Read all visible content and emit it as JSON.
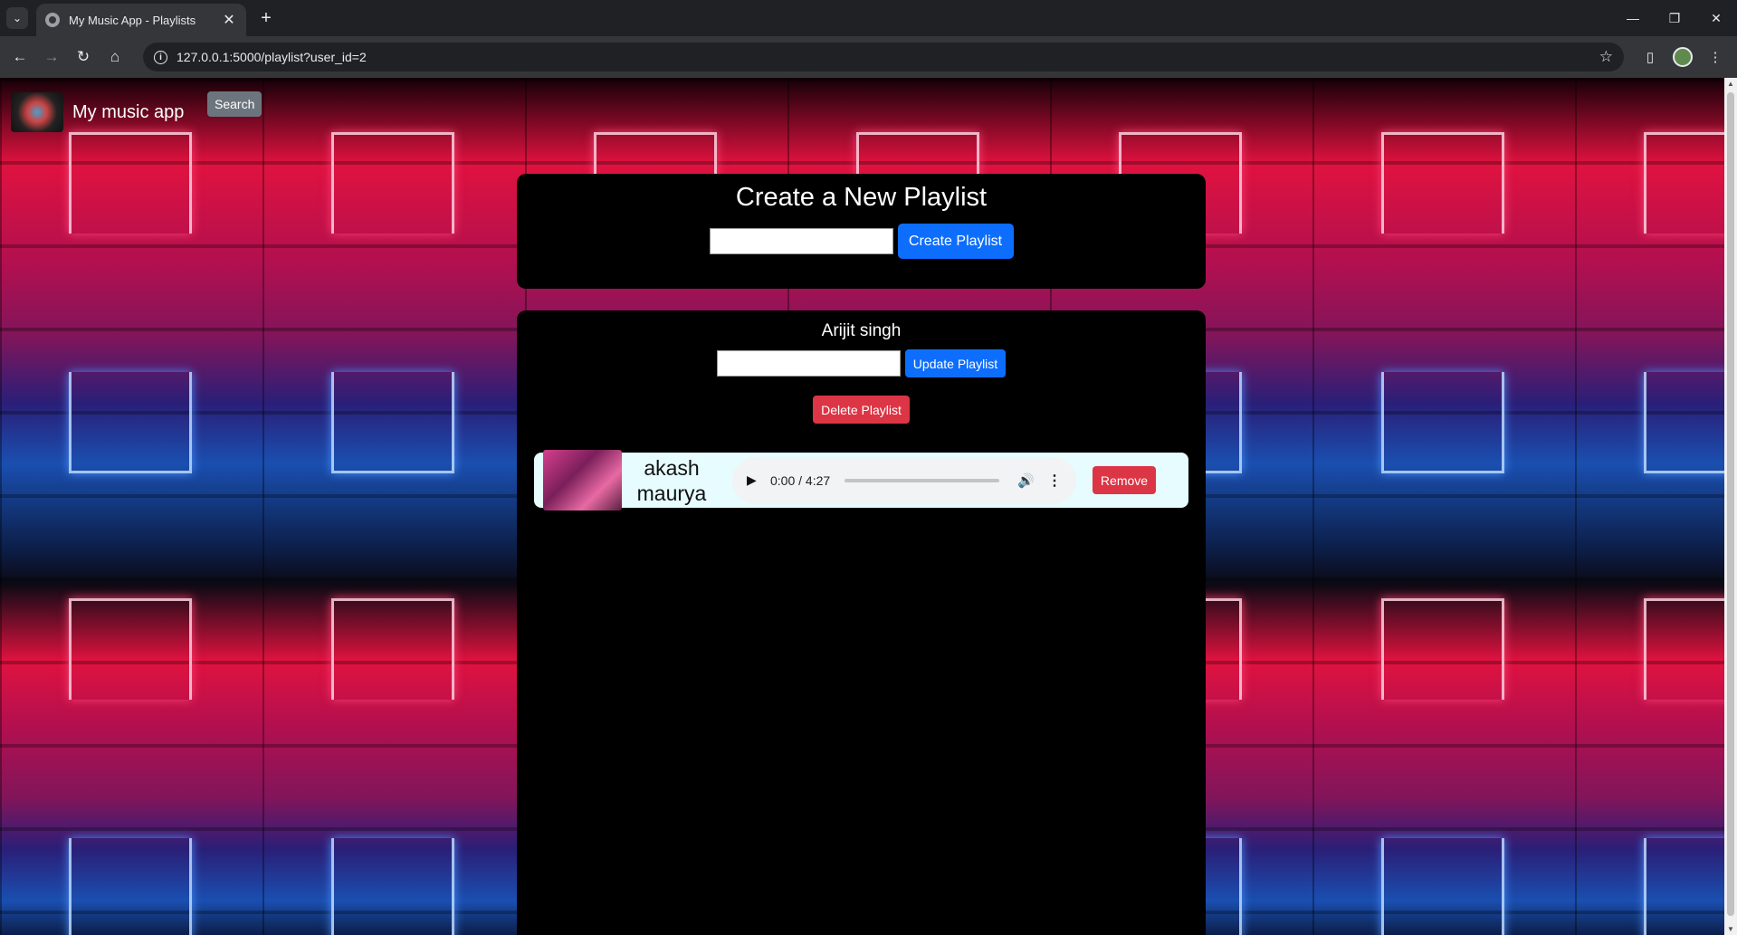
{
  "browser": {
    "tab_title": "My Music App - Playlists",
    "url": "127.0.0.1:5000/playlist?user_id=2"
  },
  "app": {
    "brand": "My music app",
    "search_label": "Search"
  },
  "create_card": {
    "title": "Create a New Playlist",
    "input_value": "",
    "button_label": "Create Playlist"
  },
  "playlist": {
    "name": "Arijit singh",
    "input_value": "",
    "update_label": "Update Playlist",
    "delete_label": "Delete Playlist",
    "songs": [
      {
        "title": "akash maurya",
        "time": "0:00 / 4:27",
        "progress": 0,
        "remove_label": "Remove"
      }
    ]
  },
  "colors": {
    "primary": "#0d6efd",
    "danger": "#dc3545",
    "secondary": "#6c757d",
    "song_row_bg": "#e6fcfe"
  }
}
